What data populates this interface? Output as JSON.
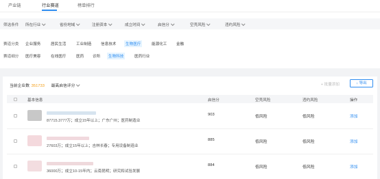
{
  "tabs": [
    {
      "label": "产业链"
    },
    {
      "label": "行业赛道"
    },
    {
      "label": "榜单排行"
    }
  ],
  "filters": {
    "label": "筛选条件",
    "dropdowns": [
      {
        "label": "所在行业"
      },
      {
        "label": "省份地域"
      },
      {
        "label": "注册资本"
      },
      {
        "label": "成立时间"
      },
      {
        "label": "启信分"
      },
      {
        "label": "空壳风险"
      },
      {
        "label": "违约风险"
      }
    ]
  },
  "tracks": {
    "label": "赛道分类",
    "chips": [
      "企业服务",
      "居民生活",
      "工业制造",
      "信息技术",
      "生物医疗",
      "能源化工",
      "金融"
    ],
    "selected": "生物医疗"
  },
  "subtracks": {
    "label": "赛道细分",
    "chips": [
      "医疗美容",
      "在线医疗",
      "医药",
      "诊所",
      "生物科技",
      "医药行业"
    ],
    "selected": "生物科技"
  },
  "summary": {
    "label": "当前企业数",
    "count": "351733",
    "sort_label": "最高启信评分"
  },
  "actions": {
    "batch_add": "+ 批量添加",
    "export": "↓ 导出"
  },
  "table": {
    "columns": [
      "基本信息",
      "启信分",
      "空壳风险",
      "违约风险",
      "操作"
    ],
    "rows": [
      {
        "info": "87715.3777万；成立15年以上；广东广州；医药制造业",
        "score": "903",
        "shell_risk": "低风险",
        "default_risk": "低风险",
        "action": "添加",
        "logo_color": "#c8c8c8",
        "bar_color": "#d7e4ef"
      },
      {
        "info": "27603万；成立15年以上；吉林长春；专用设备制造业",
        "score": "885",
        "shell_risk": "低风险",
        "default_risk": "低风险",
        "action": "添加",
        "logo_color": "#f4d9dd",
        "bar_color": "#f1d9de"
      },
      {
        "info": "36000万；成立10-15年内；云南昆明；研究和试验发展",
        "score": "884",
        "shell_risk": "低风险",
        "default_risk": "低风险",
        "action": "添加",
        "logo_color": "#f3dde0",
        "bar_color": "#efd9dc"
      }
    ]
  }
}
